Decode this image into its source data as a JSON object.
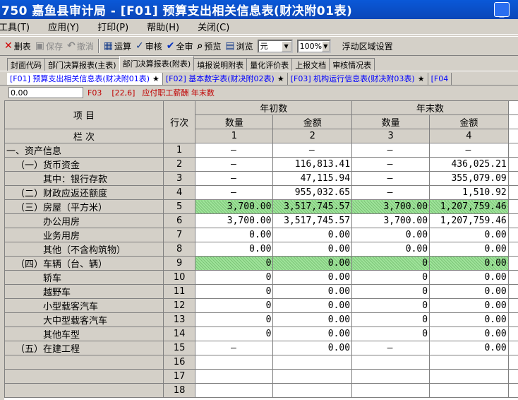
{
  "window": {
    "title": "750  嘉鱼县审计局 - [F01] 预算支出相关信息表(财决附01表)",
    "min_label": "_"
  },
  "menu": [
    "工具(T)",
    "应用(Y)",
    "打印(P)",
    "帮助(H)",
    "关闭(C)"
  ],
  "toolbar": {
    "delete": "删表",
    "save": "保存",
    "undo": "撤消",
    "calc": "运算",
    "audit": "审核",
    "audit_all": "全审",
    "preview": "预览",
    "browse": "浏览",
    "unit": "元",
    "zoom": "100%",
    "float_area": "浮动区域设置"
  },
  "tabs": [
    "封面代码",
    "部门决算报表(主表)",
    "部门决算报表(附表)",
    "填报说明附表",
    "量化评价表",
    "上报文档",
    "审核情况表"
  ],
  "active_tab": 2,
  "subtabs": [
    {
      "label": "[F01] 预算支出相关信息表(财决附01表)"
    },
    {
      "label": "[F02] 基本数字表(财决附02表)"
    },
    {
      "label": "[F03] 机构运行信息表(财决附03表)"
    },
    {
      "label": "[F04"
    }
  ],
  "star": "★",
  "formula": {
    "value": "0.00",
    "sheet": "F03",
    "cell": "[22,6]",
    "desc": "应付职工薪酬 年末数"
  },
  "header": {
    "item": "项    目",
    "row_no": "行次",
    "col_begin": "年初数",
    "col_end": "年末数",
    "qty": "数量",
    "amount": "金额",
    "col_label": "栏    次",
    "c1": "1",
    "c2": "2",
    "c3": "3",
    "c4": "4"
  },
  "rows": [
    {
      "label": "一、资产信息",
      "no": "1",
      "q1": "—",
      "a1": "—",
      "q2": "—",
      "a2": "—"
    },
    {
      "label": "（一）货币资金",
      "no": "2",
      "q1": "—",
      "a1": "116,813.41",
      "q2": "—",
      "a2": "436,025.21"
    },
    {
      "label": "其中：银行存款",
      "no": "3",
      "q1": "—",
      "a1": "47,115.94",
      "q2": "—",
      "a2": "355,079.09"
    },
    {
      "label": "（二）财政应返还额度",
      "no": "4",
      "q1": "—",
      "a1": "955,032.65",
      "q2": "—",
      "a2": "1,510.92"
    },
    {
      "label": "（三）房屋（平方米）",
      "no": "5",
      "q1": "3,700.00",
      "a1": "3,517,745.57",
      "q2": "3,700.00",
      "a2": "1,207,759.46",
      "hl": true
    },
    {
      "label": "办公用房",
      "no": "6",
      "q1": "3,700.00",
      "a1": "3,517,745.57",
      "q2": "3,700.00",
      "a2": "1,207,759.46"
    },
    {
      "label": "业务用房",
      "no": "7",
      "q1": "0.00",
      "a1": "0.00",
      "q2": "0.00",
      "a2": "0.00"
    },
    {
      "label": "其他（不含构筑物）",
      "no": "8",
      "q1": "0.00",
      "a1": "0.00",
      "q2": "0.00",
      "a2": "0.00"
    },
    {
      "label": "（四）车辆（台、辆）",
      "no": "9",
      "q1": "0",
      "a1": "0.00",
      "q2": "0",
      "a2": "0.00",
      "hl": true
    },
    {
      "label": "轿车",
      "no": "10",
      "q1": "0",
      "a1": "0.00",
      "q2": "0",
      "a2": "0.00"
    },
    {
      "label": "越野车",
      "no": "11",
      "q1": "0",
      "a1": "0.00",
      "q2": "0",
      "a2": "0.00"
    },
    {
      "label": "小型载客汽车",
      "no": "12",
      "q1": "0",
      "a1": "0.00",
      "q2": "0",
      "a2": "0.00"
    },
    {
      "label": "大中型载客汽车",
      "no": "13",
      "q1": "0",
      "a1": "0.00",
      "q2": "0",
      "a2": "0.00"
    },
    {
      "label": "其他车型",
      "no": "14",
      "q1": "0",
      "a1": "0.00",
      "q2": "0",
      "a2": "0.00"
    },
    {
      "label": "（五）在建工程",
      "no": "15",
      "q1": "—",
      "a1": "0.00",
      "q2": "—",
      "a2": "0.00"
    },
    {
      "label": "",
      "no": "16",
      "q1": "",
      "a1": "",
      "q2": "",
      "a2": ""
    },
    {
      "label": "",
      "no": "17",
      "q1": "",
      "a1": "",
      "q2": "",
      "a2": ""
    },
    {
      "label": "",
      "no": "18",
      "q1": "",
      "a1": "",
      "q2": "",
      "a2": ""
    }
  ],
  "indents": [
    0,
    1,
    4,
    1,
    1,
    4,
    4,
    4,
    1,
    4,
    4,
    4,
    4,
    4,
    1,
    0,
    0,
    0
  ]
}
